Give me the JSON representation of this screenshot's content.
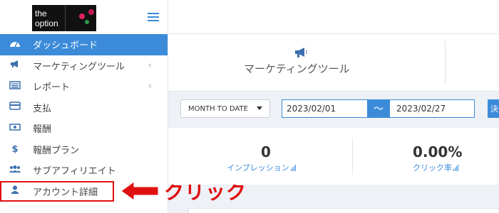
{
  "logo": {
    "line1": "the",
    "line2": "option"
  },
  "sidebar": {
    "items": [
      {
        "label": "ダッシュボード",
        "icon": "dashboard-icon",
        "active": true
      },
      {
        "label": "マーケティングツール",
        "icon": "megaphone-icon",
        "chevron": "‹"
      },
      {
        "label": "レポート",
        "icon": "report-icon",
        "chevron": "‹"
      },
      {
        "label": "支払",
        "icon": "credit-card-icon"
      },
      {
        "label": "報酬",
        "icon": "money-icon"
      },
      {
        "label": "報酬プラン",
        "icon": "dollar-icon",
        "glyph": "$"
      },
      {
        "label": "サブアフィリエイト",
        "icon": "users-icon"
      },
      {
        "label": "アカウント詳細",
        "icon": "user-icon"
      }
    ]
  },
  "annotation": {
    "text": "クリック",
    "color": "#e01010"
  },
  "main": {
    "tool_label": "マーケティングツール",
    "filter_value": "MONTH TO DATE",
    "date_from": "2023/02/01",
    "date_separator": "～",
    "date_to": "2023/02/27",
    "go_label": "決",
    "stats": [
      {
        "value": "0",
        "label": "インプレッション"
      },
      {
        "value": "0.00%",
        "label": "クリック率"
      }
    ]
  },
  "colors": {
    "accent": "#3b8bd9",
    "annotation": "#e01010"
  }
}
